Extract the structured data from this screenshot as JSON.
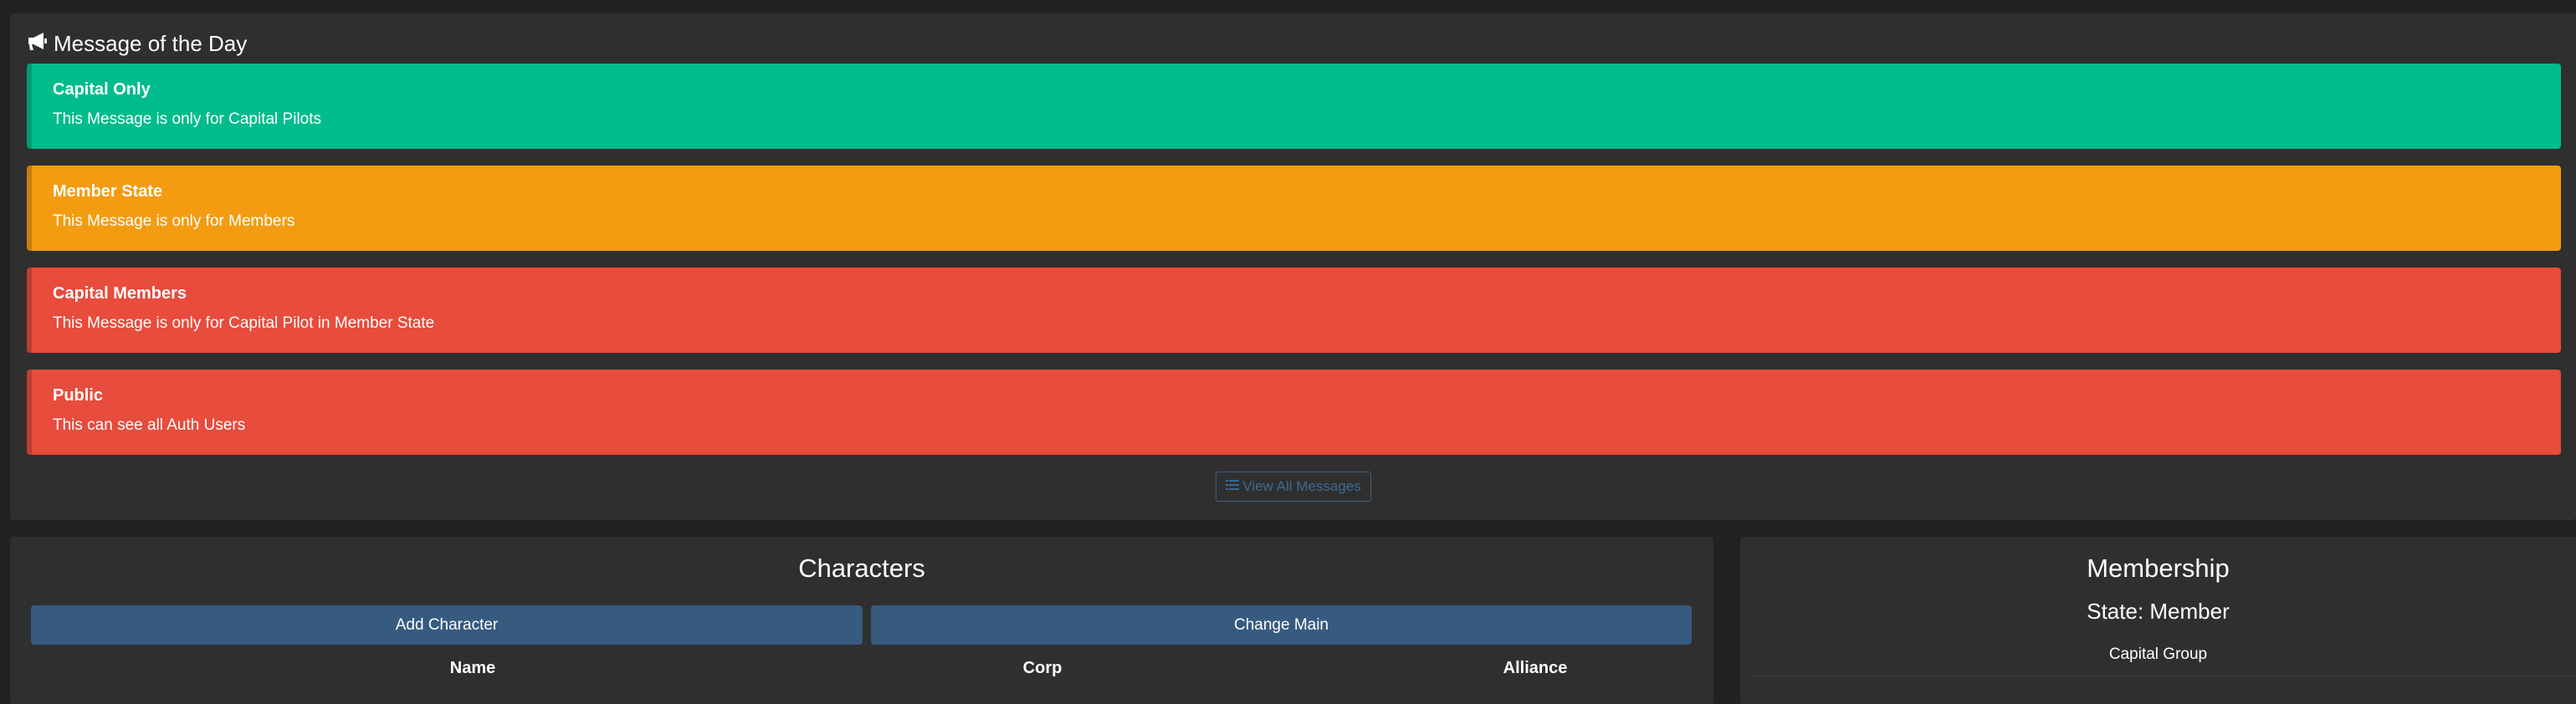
{
  "motd": {
    "title": "Message of the Day",
    "icon": "bullhorn-icon",
    "messages": [
      {
        "title": "Capital Only",
        "body": "This Message is only for Capital Pilots",
        "color": "#00bc8c"
      },
      {
        "title": "Member State",
        "body": "This Message is only for Members",
        "color": "#f39c12"
      },
      {
        "title": "Capital Members",
        "body": "This Message is only for Capital Pilot in Member State",
        "color": "#e74c3c"
      },
      {
        "title": "Public",
        "body": "This can see all Auth Users",
        "color": "#e74c3c"
      }
    ],
    "view_all_label": "View All Messages",
    "view_all_icon": "list-icon"
  },
  "characters": {
    "title": "Characters",
    "add_label": "Add Character",
    "change_main_label": "Change Main",
    "columns": [
      "Name",
      "Corp",
      "Alliance"
    ]
  },
  "membership": {
    "title": "Membership",
    "state": "State: Member",
    "group": "Capital Group"
  }
}
